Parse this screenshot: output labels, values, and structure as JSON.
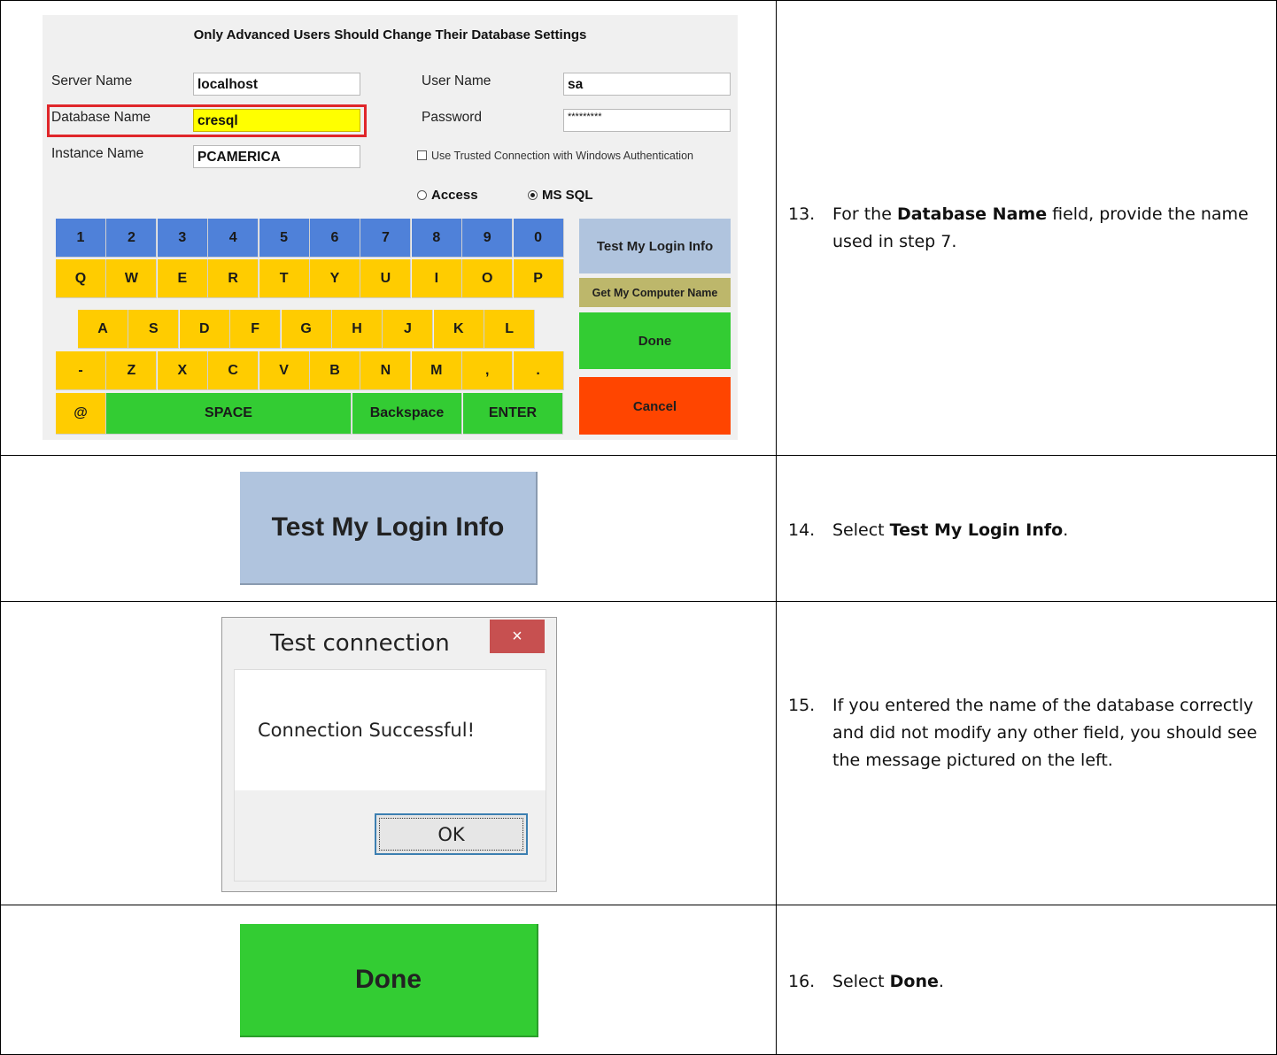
{
  "dialog": {
    "title": "Only Advanced Users Should Change Their Database Settings",
    "server_label": "Server Name",
    "server_value": "localhost",
    "database_label": "Database Name",
    "database_value": "cresql",
    "instance_label": "Instance Name",
    "instance_value": "PCAMERICA",
    "user_label": "User Name",
    "user_value": "sa",
    "password_label": "Password",
    "password_value": "*********",
    "trusted_label": "Use Trusted Connection with Windows Authentication",
    "radio_access": "Access",
    "radio_mssql": "MS SQL",
    "row1": [
      "1",
      "2",
      "3",
      "4",
      "5",
      "6",
      "7",
      "8",
      "9",
      "0"
    ],
    "row2": [
      "Q",
      "W",
      "E",
      "R",
      "T",
      "Y",
      "U",
      "I",
      "O",
      "P"
    ],
    "row3": [
      "A",
      "S",
      "D",
      "F",
      "G",
      "H",
      "J",
      "K",
      "L"
    ],
    "row4": [
      "-",
      "Z",
      "X",
      "C",
      "V",
      "B",
      "N",
      "M",
      ",",
      "."
    ],
    "at_key": "@",
    "space_key": "SPACE",
    "backspace_key": "Backspace",
    "enter_key": "ENTER",
    "test_button": "Test My Login Info",
    "computer_name_button": "Get My Computer Name",
    "done_button": "Done",
    "cancel_button": "Cancel"
  },
  "big_test_button": "Test My Login Info",
  "test_window": {
    "title": "Test connection",
    "close": "×",
    "message": "Connection Successful!",
    "ok": "OK"
  },
  "big_done_button": "Done",
  "steps": [
    {
      "num": "13.",
      "pre": "For the ",
      "bold": "Database Name",
      "post": " field, provide the name used in step 7."
    },
    {
      "num": "14.",
      "pre": "Select ",
      "bold": "Test My Login Info",
      "post": "."
    },
    {
      "num": "15.",
      "text": "If you entered the name of the database correctly and did not modify any other field, you should see the message pictured on the left."
    },
    {
      "num": "16.",
      "pre": "Select ",
      "bold": "Done",
      "post": "."
    }
  ],
  "colors": {
    "key_blue": "#4f81d9",
    "key_yellow": "#ffcc00",
    "key_green": "#33cc33",
    "test_btn": "#b0c4de",
    "computer_btn": "#bdb76b",
    "cancel_btn": "#ff4500",
    "highlight": "#e0262a"
  }
}
